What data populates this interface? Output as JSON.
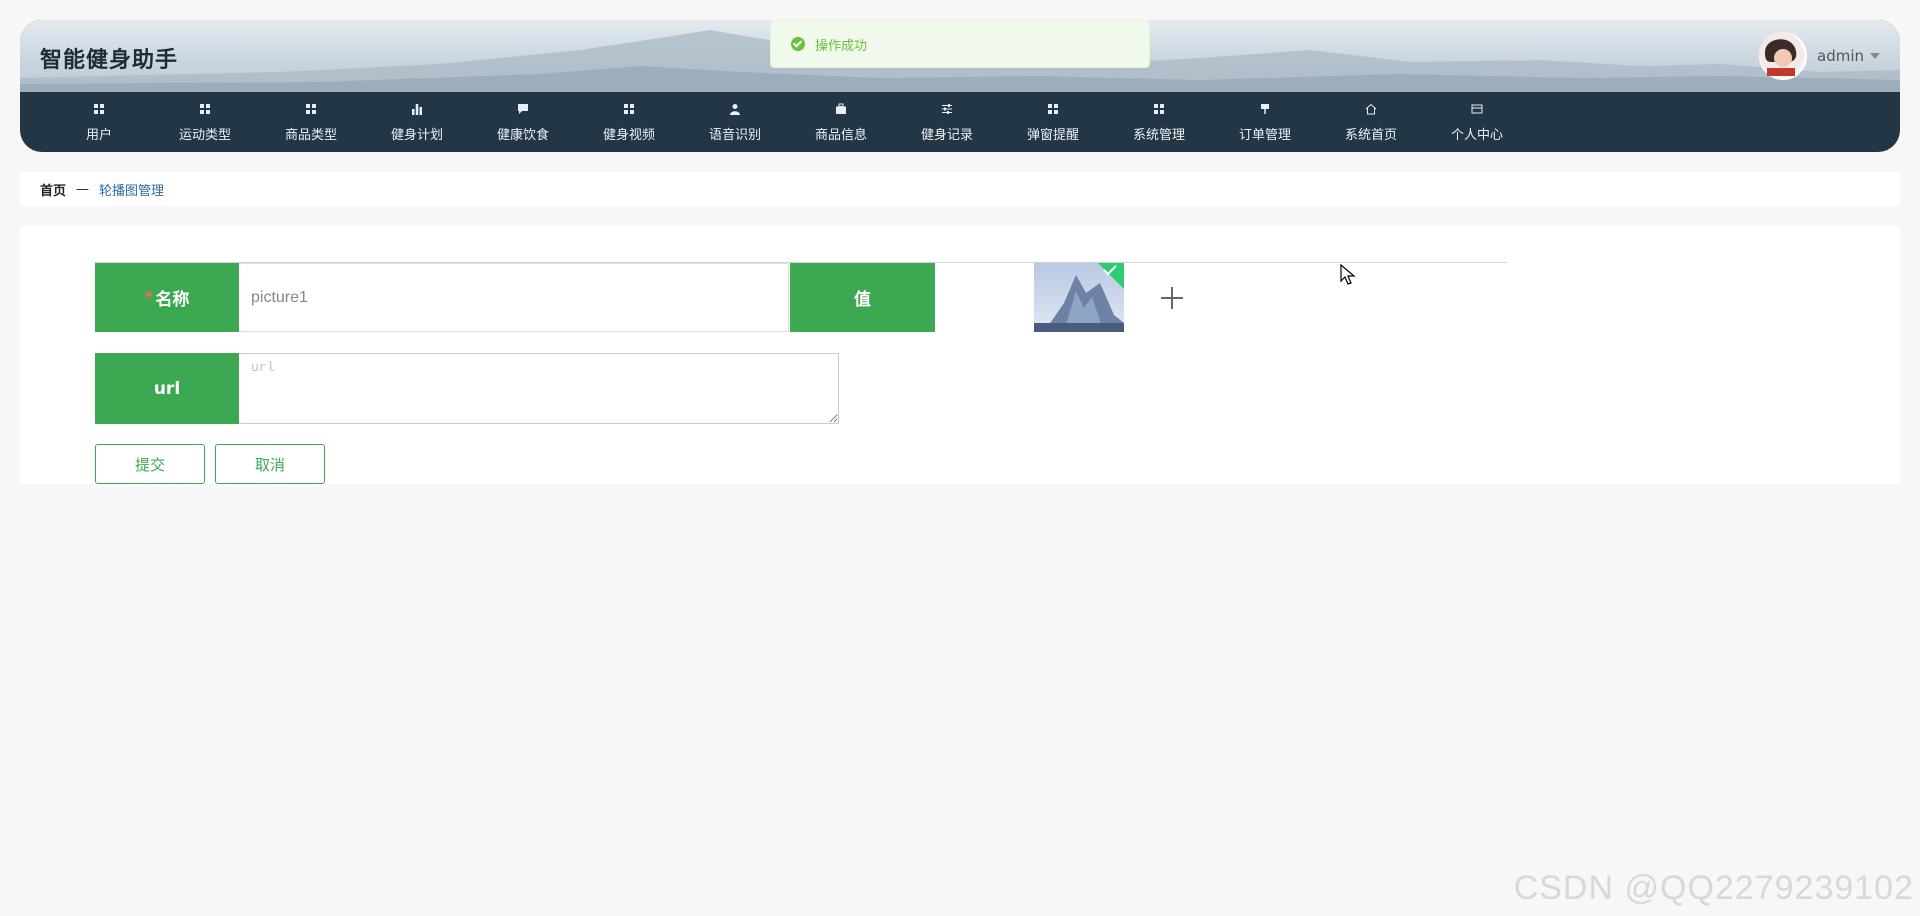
{
  "app": {
    "title": "智能健身助手"
  },
  "user": {
    "name": "admin"
  },
  "toast": {
    "message": "操作成功"
  },
  "nav": [
    {
      "label": "用户",
      "icon": "grid-icon"
    },
    {
      "label": "运动类型",
      "icon": "grid-icon"
    },
    {
      "label": "商品类型",
      "icon": "grid-icon"
    },
    {
      "label": "健身计划",
      "icon": "bar-chart-icon"
    },
    {
      "label": "健康饮食",
      "icon": "chat-bubble-icon"
    },
    {
      "label": "健身视频",
      "icon": "grid-icon"
    },
    {
      "label": "语音识别",
      "icon": "person-icon"
    },
    {
      "label": "商品信息",
      "icon": "briefcase-icon"
    },
    {
      "label": "健身记录",
      "icon": "sliders-icon"
    },
    {
      "label": "弹窗提醒",
      "icon": "grid-icon"
    },
    {
      "label": "系统管理",
      "icon": "grid-icon"
    },
    {
      "label": "订单管理",
      "icon": "pin-icon"
    },
    {
      "label": "系统首页",
      "icon": "home-icon"
    },
    {
      "label": "个人中心",
      "icon": "card-icon"
    }
  ],
  "breadcrumb": {
    "home": "首页",
    "separator": "—",
    "current": "轮播图管理"
  },
  "form": {
    "name_label": "名称",
    "required_mark": "*",
    "name_value": "picture1",
    "value_label": "值",
    "url_label": "url",
    "url_placeholder": "url",
    "submit_label": "提交",
    "cancel_label": "取消"
  },
  "watermark": "CSDN @QQ2279239102",
  "colors": {
    "accent": "#3ca852",
    "nav_bg": "#233645",
    "link": "#2d6aa3",
    "success": "#67c23a"
  }
}
